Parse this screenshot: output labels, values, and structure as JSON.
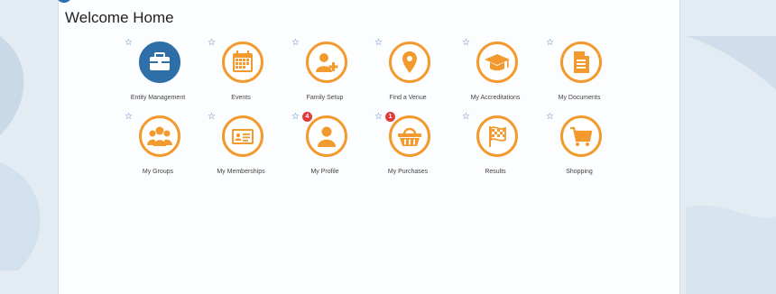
{
  "page": {
    "title": "Welcome Home"
  },
  "colors": {
    "accent": "#f39a2e",
    "primary_blue": "#2e6fa8",
    "badge_red": "#e03a3a",
    "star_blue": "#3d6fb0"
  },
  "tiles": [
    {
      "label": "Entity Management",
      "icon": "briefcase-icon",
      "badge": null
    },
    {
      "label": "Events",
      "icon": "calendar-icon",
      "badge": null
    },
    {
      "label": "Family Setup",
      "icon": "add-person-icon",
      "badge": null
    },
    {
      "label": "Find a Venue",
      "icon": "location-pin-icon",
      "badge": null
    },
    {
      "label": "My Accreditations",
      "icon": "graduation-cap-icon",
      "badge": null
    },
    {
      "label": "My Documents",
      "icon": "document-icon",
      "badge": null
    },
    {
      "label": "My Groups",
      "icon": "group-icon",
      "badge": null
    },
    {
      "label": "My Memberships",
      "icon": "id-card-icon",
      "badge": null
    },
    {
      "label": "My Profile",
      "icon": "person-icon",
      "badge": "4"
    },
    {
      "label": "My Purchases",
      "icon": "basket-icon",
      "badge": "1"
    },
    {
      "label": "Results",
      "icon": "checkered-flag-icon",
      "badge": null
    },
    {
      "label": "Shopping",
      "icon": "shopping-cart-icon",
      "badge": null
    }
  ],
  "star_glyph": "☆"
}
